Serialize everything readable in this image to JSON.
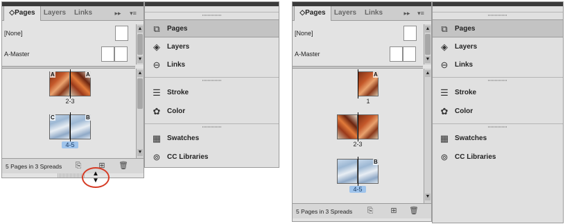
{
  "left": {
    "tabs": [
      {
        "label": "◇Pages"
      },
      {
        "label": "Layers"
      },
      {
        "label": "Links"
      }
    ],
    "overflow_label": "▸▸",
    "menu_label": "▾≡",
    "masters": [
      {
        "label": "[None]"
      },
      {
        "label": "A-Master"
      }
    ],
    "spreads": [
      {
        "number": "2-3",
        "left_letter": "A",
        "right_letter": "A",
        "selected": false
      },
      {
        "number": "4-5",
        "left_letter": "C",
        "right_letter": "B",
        "selected": true
      }
    ],
    "footer_text": "5 Pages in 3 Spreads",
    "dock_items": [
      {
        "label": "Pages",
        "icon": "pages-icon",
        "glyph": "⧉"
      },
      {
        "label": "Layers",
        "icon": "layers-icon",
        "glyph": "◈"
      },
      {
        "label": "Links",
        "icon": "links-icon",
        "glyph": "⊖"
      },
      {
        "label": "Stroke",
        "icon": "stroke-icon",
        "glyph": "☰"
      },
      {
        "label": "Color",
        "icon": "color-icon",
        "glyph": "✿"
      },
      {
        "label": "Swatches",
        "icon": "swatches-icon",
        "glyph": "▦"
      },
      {
        "label": "CC Libraries",
        "icon": "cc-libraries-icon",
        "glyph": "⊚"
      }
    ]
  },
  "right": {
    "tabs": [
      {
        "label": "◇Pages"
      },
      {
        "label": "Layers"
      },
      {
        "label": "Links"
      }
    ],
    "overflow_label": "▸▸",
    "menu_label": "▾≡",
    "masters": [
      {
        "label": "[None]"
      },
      {
        "label": "A-Master"
      }
    ],
    "spreads": [
      {
        "number": "1",
        "right_letter": "A"
      },
      {
        "number": "2-3"
      },
      {
        "number": "4-5",
        "right_letter": "B",
        "selected": true
      }
    ],
    "footer_text": "5 Pages in 3 Spreads",
    "dock_items": [
      {
        "label": "Pages",
        "icon": "pages-icon",
        "glyph": "⧉"
      },
      {
        "label": "Layers",
        "icon": "layers-icon",
        "glyph": "◈"
      },
      {
        "label": "Links",
        "icon": "links-icon",
        "glyph": "⊖"
      },
      {
        "label": "Stroke",
        "icon": "stroke-icon",
        "glyph": "☰"
      },
      {
        "label": "Color",
        "icon": "color-icon",
        "glyph": "✿"
      },
      {
        "label": "Swatches",
        "icon": "swatches-icon",
        "glyph": "▦"
      },
      {
        "label": "CC Libraries",
        "icon": "cc-libraries-icon",
        "glyph": "⊚"
      }
    ]
  },
  "icons": {
    "new_page": "⊞",
    "duplicate": "⎘",
    "trash": "🗑",
    "resize_up": "▲",
    "resize_down": "▼"
  },
  "colors": {
    "highlight": "#9fc4ec",
    "resize_circle": "#d63b25"
  }
}
